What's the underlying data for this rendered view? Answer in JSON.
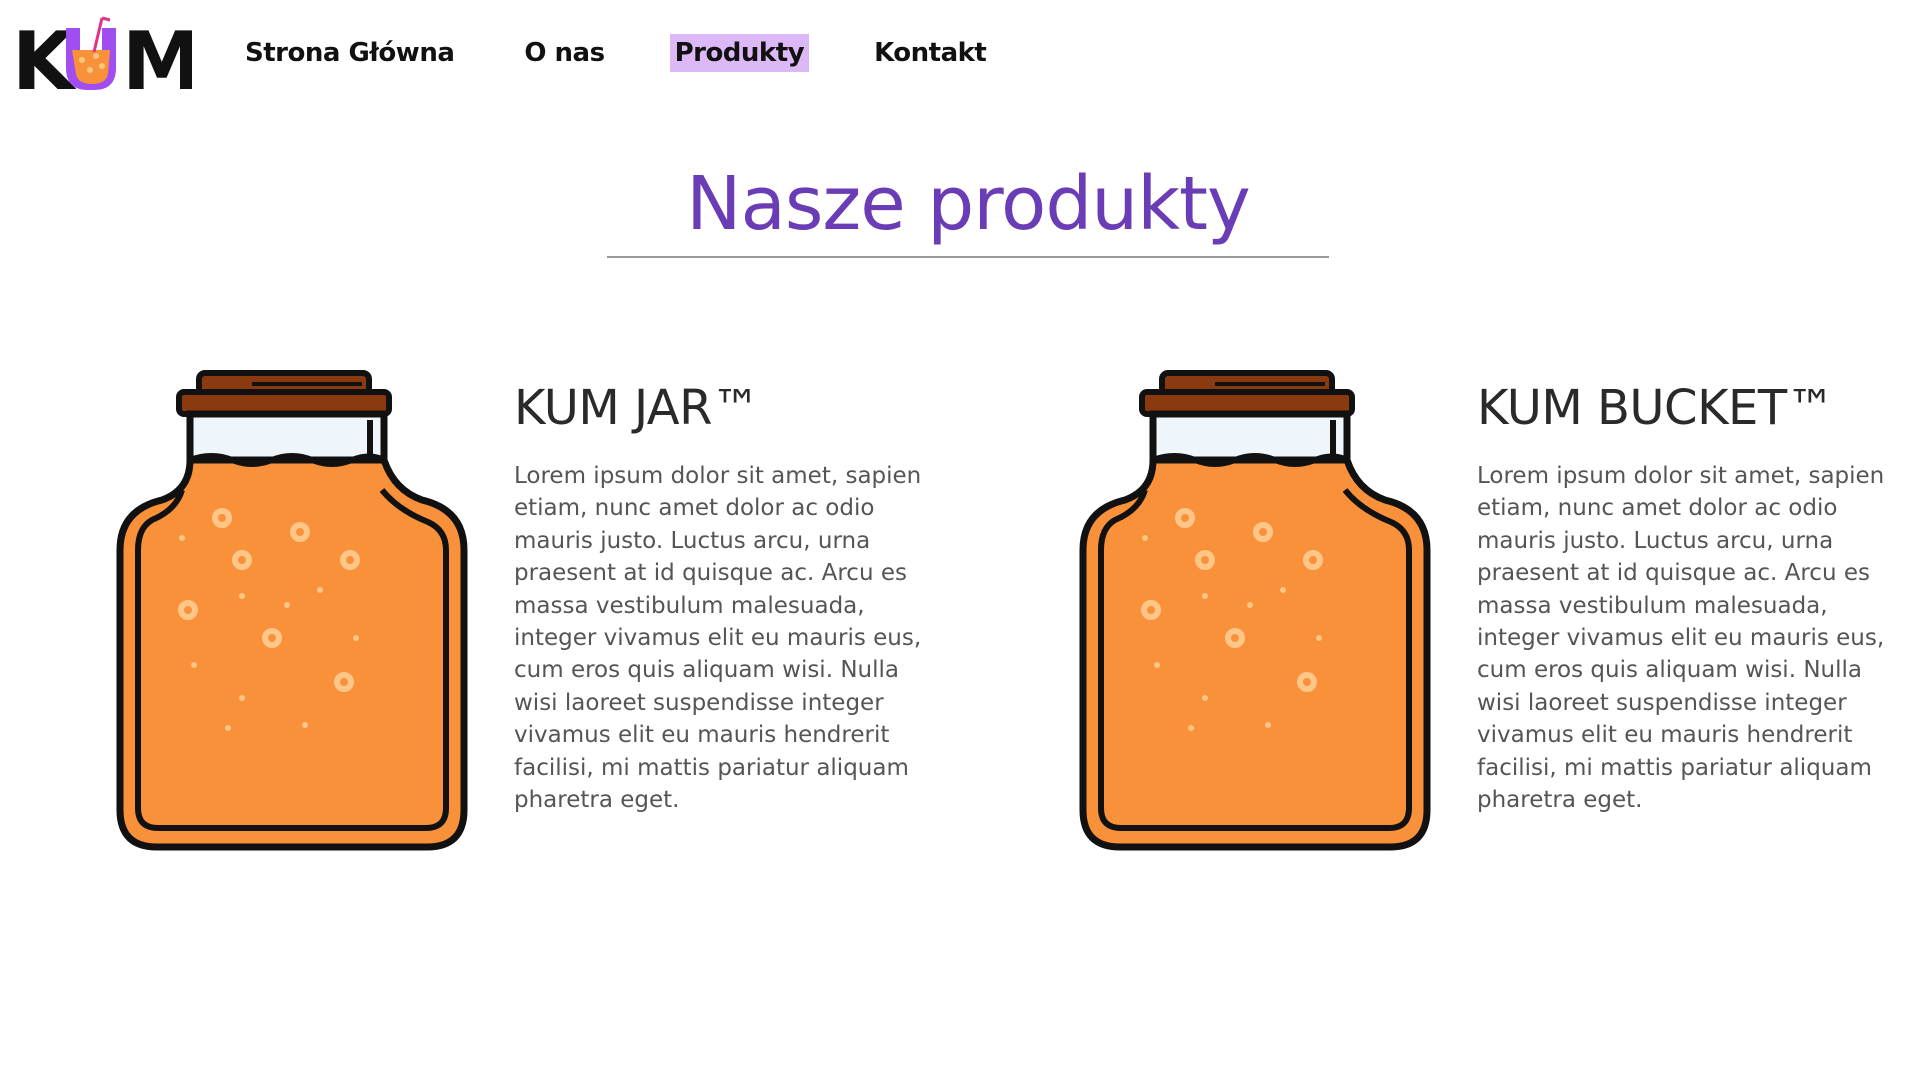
{
  "logo": {
    "text": "KUM",
    "icon": "juice-cup-logo"
  },
  "nav": {
    "items": [
      {
        "label": "Strona Główna",
        "active": false
      },
      {
        "label": "O nas",
        "active": false
      },
      {
        "label": "Produkty",
        "active": true
      },
      {
        "label": "Kontakt",
        "active": false
      }
    ]
  },
  "page": {
    "title": "Nasze produkty"
  },
  "products": [
    {
      "name": "KUM JAR™",
      "icon": "orange-jar-icon",
      "description": "Lorem ipsum dolor sit amet, sapien etiam, nunc amet dolor ac odio mauris justo. Luctus arcu, urna praesent at id quisque ac. Arcu es massa vestibulum malesuada, integer vivamus elit eu mauris eus, cum eros quis aliquam wisi. Nulla wisi laoreet suspendisse integer vivamus elit eu mauris hendrerit facilisi, mi mattis pariatur aliquam pharetra eget."
    },
    {
      "name": "KUM BUCKET™",
      "icon": "orange-jar-icon",
      "description": "Lorem ipsum dolor sit amet, sapien etiam, nunc amet dolor ac odio mauris justo. Luctus arcu, urna praesent at id quisque ac. Arcu es massa vestibulum malesuada, integer vivamus elit eu mauris eus, cum eros quis aliquam wisi. Nulla wisi laoreet suspendisse integer vivamus elit eu mauris hendrerit facilisi, mi mattis pariatur aliquam pharetra eget."
    }
  ],
  "colors": {
    "accent": "#6a3cb5",
    "nav_active_bg": "#dcb8f7",
    "jar_fill": "#f9913b",
    "jar_lid": "#8b3a0f",
    "jar_glass": "#eef6fc",
    "logo_purple": "#a14ef0"
  }
}
